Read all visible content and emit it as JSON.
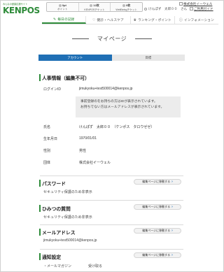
{
  "header": {
    "logo_tagline": "みんなの健康応援サイト",
    "logo_text": "KENPOS",
    "points": [
      {
        "value": "0pt",
        "label": "ポイント"
      },
      {
        "value": "12枚",
        "label": "KENPOSチケット"
      },
      {
        "value": "0枚",
        "label": "WellBeingチケット"
      }
    ],
    "user_name": "けんぽず　太郎００　さん",
    "company_link": "株式会社イーウェル",
    "guide_link": "ご利用ガイド"
  },
  "nav": [
    {
      "icon": "✎",
      "label": "毎日の記録"
    },
    {
      "icon": "♡",
      "label": "健診・ヘルスケア"
    },
    {
      "icon": "♛",
      "label": "ランキング・ポイント"
    },
    {
      "icon": "ⓘ",
      "label": "インフォメーション"
    }
  ],
  "page_title": "マイページ",
  "tabs": [
    "アカウント",
    "目標"
  ],
  "personal": {
    "section_title": "人事情報（編集不可）",
    "login_id_label": "ログインID",
    "login_id_value": "jimukyoku+test500014@kenpos.jp",
    "note_line1": "事前登録のをお持ちの方はIDが表示されています。",
    "note_line2": "お持ちでない方はメールアドレスが表示されています。",
    "name_label": "氏名",
    "name_value": "けんぽず　太郎００　（ケンポス　タロウゼゼ）",
    "birth_label": "生年月日",
    "birth_value": "1970/01/01",
    "gender_label": "性別",
    "gender_value": "男性",
    "group_label": "団体",
    "group_value": "株式会社イーウェル"
  },
  "password": {
    "title": "パスワード",
    "button": "編集ページに移動する",
    "text": "セキュリティ保護のため非表示"
  },
  "secret": {
    "title": "ひみつの質問",
    "button": "編集ページに移動する",
    "text": "セキュリティ保護のため非表示"
  },
  "email": {
    "title": "メールアドレス",
    "button": "編集ページに移動する",
    "text": "jimukyoku+test500014@kenpos.jp"
  },
  "notify": {
    "title": "通知設定",
    "button": "編集ページに移動する",
    "item_label": "・メールマガジン",
    "item_value": "受け取る"
  },
  "colors": {
    "brand_green": "#2e8b3a",
    "tab_blue": "#1f6fb5"
  }
}
